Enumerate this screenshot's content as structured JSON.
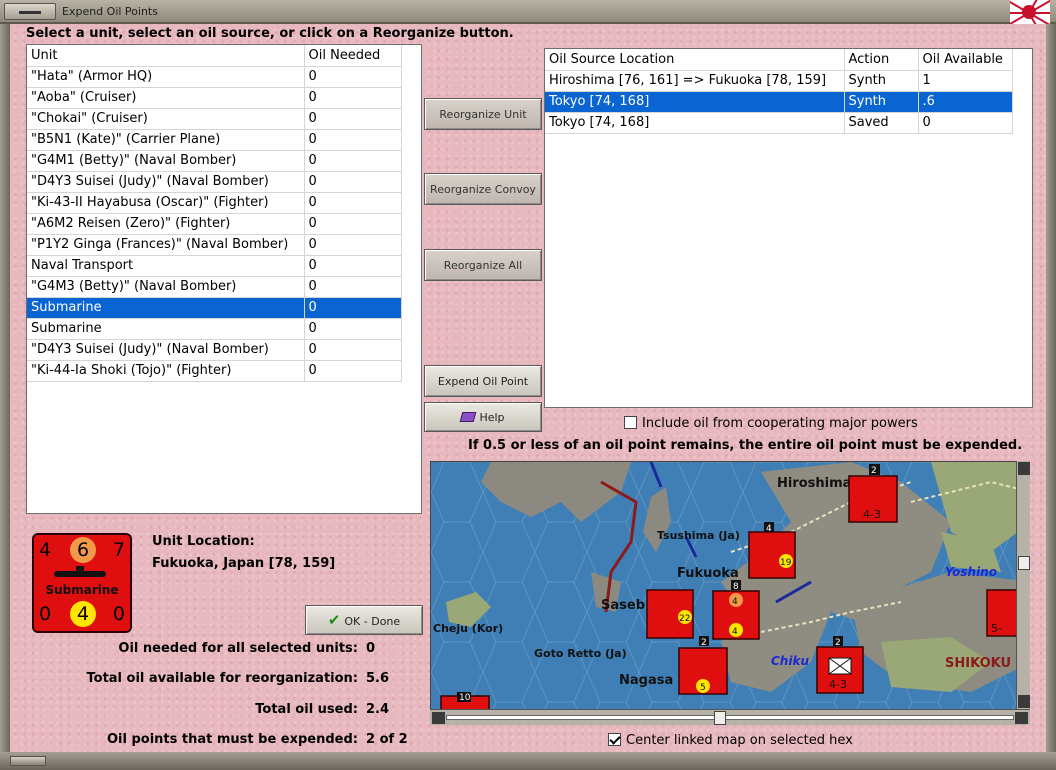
{
  "window": {
    "title": "Expend Oil Points"
  },
  "instruction": "Select a unit, select an oil source, or click on a Reorganize button.",
  "unit_table": {
    "headers": [
      "Unit",
      "Oil Needed"
    ],
    "rows": [
      [
        "\"Hata\" (Armor HQ)",
        "0"
      ],
      [
        "\"Aoba\" (Cruiser)",
        "0"
      ],
      [
        "\"Chokai\" (Cruiser)",
        "0"
      ],
      [
        "\"B5N1 (Kate)\" (Carrier Plane)",
        "0"
      ],
      [
        "\"G4M1 (Betty)\" (Naval Bomber)",
        "0"
      ],
      [
        "\"D4Y3 Suisei (Judy)\" (Naval Bomber)",
        "0"
      ],
      [
        "\"Ki-43-II Hayabusa (Oscar)\" (Fighter)",
        "0"
      ],
      [
        "\"A6M2 Reisen (Zero)\" (Fighter)",
        "0"
      ],
      [
        "\"P1Y2 Ginga (Frances)\" (Naval Bomber)",
        "0"
      ],
      [
        "Naval Transport",
        "0"
      ],
      [
        "\"G4M3 (Betty)\" (Naval Bomber)",
        "0"
      ],
      [
        "Submarine",
        "0"
      ],
      [
        "Submarine",
        "0"
      ],
      [
        "\"D4Y3 Suisei (Judy)\" (Naval Bomber)",
        "0"
      ],
      [
        "\"Ki-44-Ia Shoki (Tojo)\" (Fighter)",
        "0"
      ]
    ],
    "selected_index": 11
  },
  "oil_table": {
    "headers": [
      "Oil Source Location",
      "Action",
      "Oil Available"
    ],
    "rows": [
      [
        "Hiroshima [76, 161] => Fukuoka [78, 159]",
        "Synth",
        "1"
      ],
      [
        "Tokyo [74, 168]",
        "Synth",
        ".6"
      ],
      [
        "Tokyo [74, 168]",
        "Saved",
        "0"
      ]
    ],
    "selected_index": 1
  },
  "buttons": {
    "reorganize_unit": "Reorganize Unit",
    "reorganize_convoy": "Reorganize Convoy",
    "reorganize_all": "Reorganize All",
    "expend_oil_point": "Expend Oil Point",
    "help": "Help",
    "ok_done": "OK - Done"
  },
  "include_oil": {
    "label": "Include oil from cooperating major powers",
    "checked": false
  },
  "oil_note": "If 0.5 or less of an oil point remains, the entire oil point must be expended.",
  "counter": {
    "top_left": "4",
    "top_mid": "6",
    "top_right": "7",
    "bottom_left": "0",
    "bottom_mid": "4",
    "bottom_right": "0",
    "label": "Submarine",
    "icon": "submarine-icon"
  },
  "unit_location": {
    "label": "Unit Location:",
    "value": "Fukuoka, Japan [78, 159]"
  },
  "stats": [
    {
      "label": "Oil needed for all selected units:",
      "value": "0"
    },
    {
      "label": "Total oil available for reorganization:",
      "value": "5.6"
    },
    {
      "label": "Total oil used:",
      "value": "2.4"
    },
    {
      "label": "Oil points that must be expended:",
      "value": "2 of 2"
    }
  ],
  "map": {
    "labels": [
      "Hiroshima",
      "Tsushima (Ja)",
      "Fukuoka",
      "Saseb",
      "Cheju (Kor)",
      "Goto Retto (Ja)",
      "Nagasa",
      "Yoshino",
      "Chiku",
      "SHIKOKU"
    ],
    "counter_values": [
      "2",
      "4-3",
      "4",
      "19",
      "8",
      "22",
      "4",
      "4",
      "2",
      "5",
      "2",
      "4-3",
      "10",
      "5-"
    ]
  },
  "center_map": {
    "label": "Center linked map on selected hex",
    "checked": true
  },
  "colors": {
    "selection": "#0a64d2",
    "background": "#e8b8bf",
    "counter": "#e00f0f"
  }
}
